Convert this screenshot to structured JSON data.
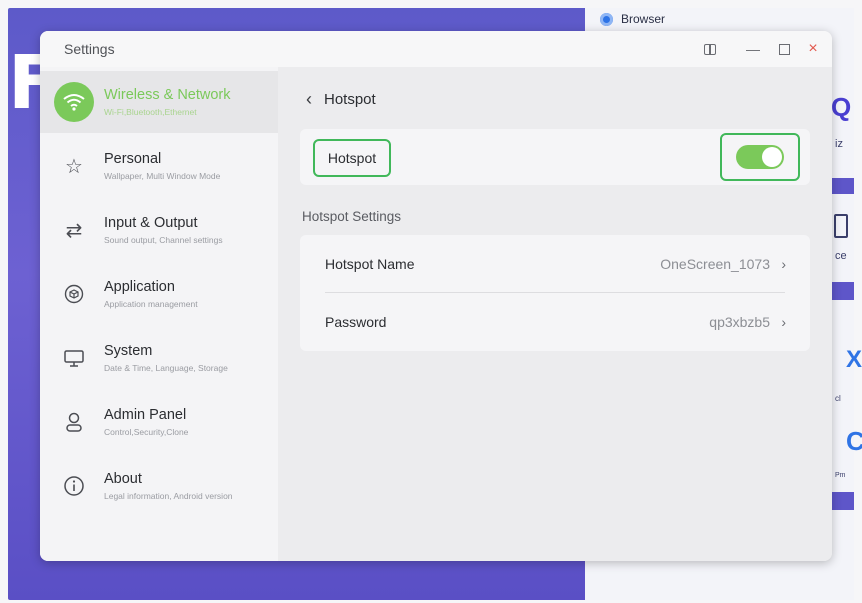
{
  "desktop": {
    "letter": "F"
  },
  "browser": {
    "label": "Browser"
  },
  "edge": {
    "text1": "iz",
    "text2": "ce",
    "text3": "cl",
    "text4": "Pm"
  },
  "window": {
    "title": "Settings",
    "controls": {
      "split": "split-view-icon",
      "minimize": "—",
      "maximize": "maximize-icon",
      "close": "×"
    }
  },
  "sidebar": {
    "items": [
      {
        "label": "Wireless & Network",
        "sub": "Wi-Fi,Bluetooth,Ethernet",
        "icon": "wifi-icon",
        "active": true
      },
      {
        "label": "Personal",
        "sub": "Wallpaper, Multi Window Mode",
        "icon": "star-icon"
      },
      {
        "label": "Input & Output",
        "sub": "Sound output, Channel settings",
        "icon": "swap-arrows-icon"
      },
      {
        "label": "Application",
        "sub": "Application management",
        "icon": "cube-icon"
      },
      {
        "label": "System",
        "sub": "Date & Time, Language, Storage",
        "icon": "monitor-icon"
      },
      {
        "label": "Admin Panel",
        "sub": "Control,Security,Clone",
        "icon": "user-icon"
      },
      {
        "label": "About",
        "sub": "Legal information, Android version",
        "icon": "info-icon"
      }
    ]
  },
  "content": {
    "page_title": "Hotspot",
    "hotspot_toggle_label": "Hotspot",
    "hotspot_enabled": true,
    "section_title": "Hotspot Settings",
    "settings": [
      {
        "label": "Hotspot Name",
        "value": "OneScreen_1073"
      },
      {
        "label": "Password",
        "value": "qp3xbzb5"
      }
    ]
  },
  "colors": {
    "accent": "#7bc95a",
    "highlight": "#41b85a",
    "close": "#e2574c"
  }
}
